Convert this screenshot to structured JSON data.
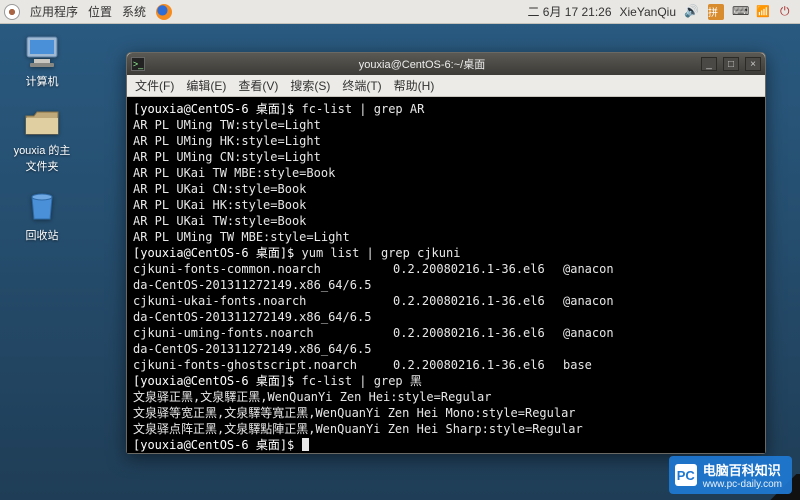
{
  "panel": {
    "menus": {
      "apps": "应用程序",
      "places": "位置",
      "system": "系统"
    },
    "datetime": "二  6月 17 21:26",
    "user": "XieYanQiu",
    "input_badge": "拼"
  },
  "desktop": {
    "computer": "计算机",
    "home": "youxia 的主文件夹",
    "trash": "回收站"
  },
  "window": {
    "title": "youxia@CentOS-6:~/桌面",
    "menus": {
      "file": "文件(F)",
      "edit": "编辑(E)",
      "view": "查看(V)",
      "search": "搜索(S)",
      "terminal": "终端(T)",
      "help": "帮助(H)"
    }
  },
  "term": {
    "prompt": "[youxia@CentOS-6 桌面]$ ",
    "cmd1": "fc-list | grep AR",
    "fc_ar": [
      "AR PL UMing TW:style=Light",
      "AR PL UMing HK:style=Light",
      "AR PL UMing CN:style=Light",
      "AR PL UKai TW MBE:style=Book",
      "AR PL UKai CN:style=Book",
      "AR PL UKai HK:style=Book",
      "AR PL UKai TW:style=Book",
      "AR PL UMing TW MBE:style=Light"
    ],
    "cmd2": "yum list | grep cjkuni",
    "yum": [
      {
        "name": "cjkuni-fonts-common.noarch",
        "ver": "0.2.20080216.1-36.el6",
        "repo": "@anacon"
      },
      {
        "name": "da-CentOS-201311272149.x86_64/6.5",
        "ver": "",
        "repo": ""
      },
      {
        "name": "cjkuni-ukai-fonts.noarch",
        "ver": "0.2.20080216.1-36.el6",
        "repo": "@anacon"
      },
      {
        "name": "da-CentOS-201311272149.x86_64/6.5",
        "ver": "",
        "repo": ""
      },
      {
        "name": "cjkuni-uming-fonts.noarch",
        "ver": "0.2.20080216.1-36.el6",
        "repo": "@anacon"
      },
      {
        "name": "da-CentOS-201311272149.x86_64/6.5",
        "ver": "",
        "repo": ""
      },
      {
        "name": "cjkuni-fonts-ghostscript.noarch",
        "ver": "0.2.20080216.1-36.el6",
        "repo": "base"
      }
    ],
    "cmd3": "fc-list | grep 黑",
    "fc_hei": [
      "文泉驿正黑,文泉驛正黑,WenQuanYi Zen Hei:style=Regular",
      "文泉驿等宽正黑,文泉驛等寬正黑,WenQuanYi Zen Hei Mono:style=Regular",
      "文泉驿点阵正黑,文泉驛點陣正黑,WenQuanYi Zen Hei Sharp:style=Regular"
    ]
  },
  "watermark": {
    "text": "电脑百科知识",
    "url": "www.pc-daily.com"
  }
}
